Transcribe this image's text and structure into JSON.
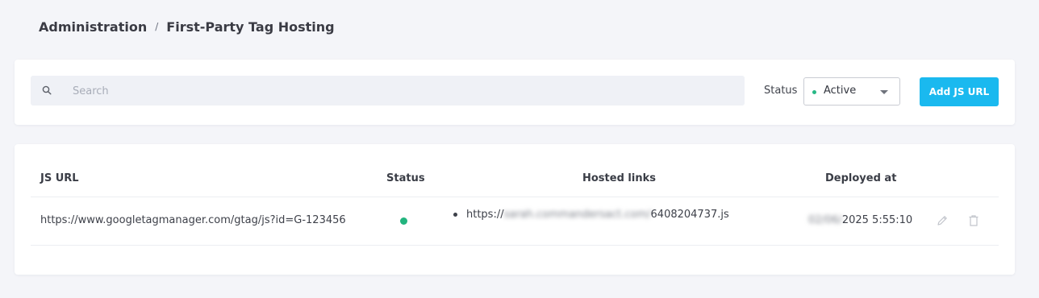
{
  "breadcrumb": {
    "parent": "Administration",
    "separator": "/",
    "current": "First-Party Tag Hosting"
  },
  "filters": {
    "search_placeholder": "Search",
    "search_value": "",
    "status_label": "Status",
    "status_value": "Active",
    "status_dot_color": "#28b886",
    "add_button_label": "Add JS URL",
    "accent_color": "#1ab9ef"
  },
  "table": {
    "columns": {
      "js_url": "JS URL",
      "status": "Status",
      "hosted_links": "Hosted links",
      "deployed_at": "Deployed at"
    },
    "rows": [
      {
        "js_url": "https://www.googletagmanager.com/gtag/js?id=G-123456",
        "status": "active",
        "hosted_link_prefix": "https://",
        "hosted_link_blurred": "sarah.commandersact.com/",
        "hosted_link_suffix": "6408204737.js",
        "deployed_blurred": "02/06/",
        "deployed_visible": "2025 5:55:10",
        "edit_icon": "pencil-icon",
        "delete_icon": "trash-icon"
      }
    ]
  }
}
